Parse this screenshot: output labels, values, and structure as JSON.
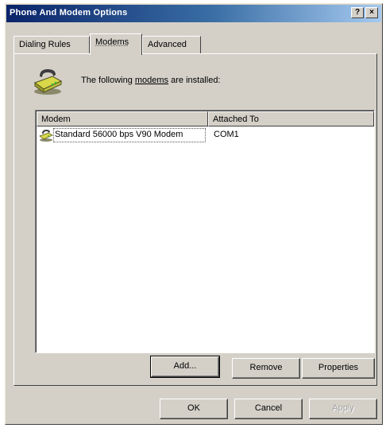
{
  "window": {
    "title": "Phone And Modem Options",
    "help_glyph": "?",
    "close_glyph": "×"
  },
  "tabs": [
    {
      "label": "Dialing Rules",
      "selected": false
    },
    {
      "label": "Modems",
      "selected": true
    },
    {
      "label": "Advanced",
      "selected": false
    }
  ],
  "modems_tab": {
    "intro_prefix": "The following ",
    "intro_link": "modems",
    "intro_suffix": " are installed:",
    "columns": [
      "Modem",
      "Attached To"
    ],
    "rows": [
      {
        "modem": "Standard 56000 bps V90 Modem",
        "port": "COM1",
        "selected": true
      }
    ],
    "buttons": {
      "add": "Add...",
      "remove": "Remove",
      "properties": "Properties"
    }
  },
  "footer": {
    "ok": "OK",
    "cancel": "Cancel",
    "apply": "Apply"
  },
  "colors": {
    "title_start": "#0a246a",
    "title_end": "#a6caf0",
    "face": "#d4d0c8"
  },
  "icons": {
    "title_help": "help-icon",
    "title_close": "close-icon",
    "header": "modem-icon",
    "row": "modem-icon"
  }
}
